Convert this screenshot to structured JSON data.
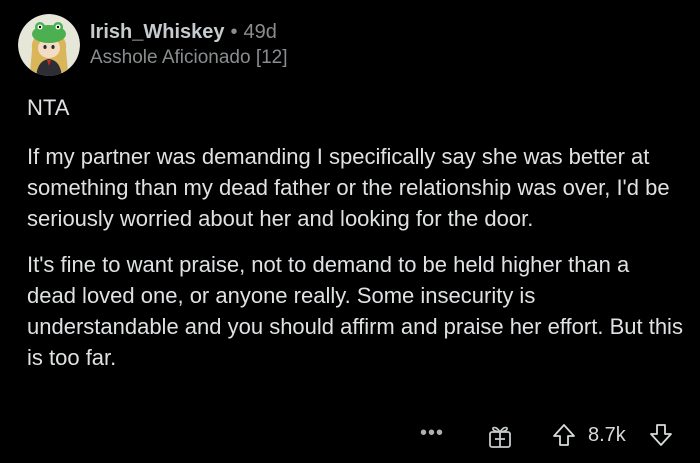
{
  "comment": {
    "username": "Irish_Whiskey",
    "separator": "•",
    "age": "49d",
    "flair": "Asshole Aficionado [12]",
    "paragraphs": [
      "NTA",
      "If my partner was demanding I specifically say she was better at something than my dead father or the relationship was over, I'd be seriously worried about her and looking for the door.",
      "It's fine to want praise, not to demand to be held higher than a dead loved one, or anyone really. Some insecurity is understandable and you should affirm and praise her effort. But this is too far."
    ]
  },
  "actions": {
    "more_label": "•••",
    "score": "8.7k"
  },
  "colors": {
    "background": "#000000",
    "text": "#dfe1e3",
    "muted": "#8a8d8f",
    "avatar_bg": "#e6e7d9",
    "avatar_hat": "#4caf50"
  },
  "icons": {
    "avatar": "snoo-avatar",
    "more": "more-options-icon",
    "award": "award-gift-icon",
    "upvote": "upvote-arrow-icon",
    "downvote": "downvote-arrow-icon"
  }
}
